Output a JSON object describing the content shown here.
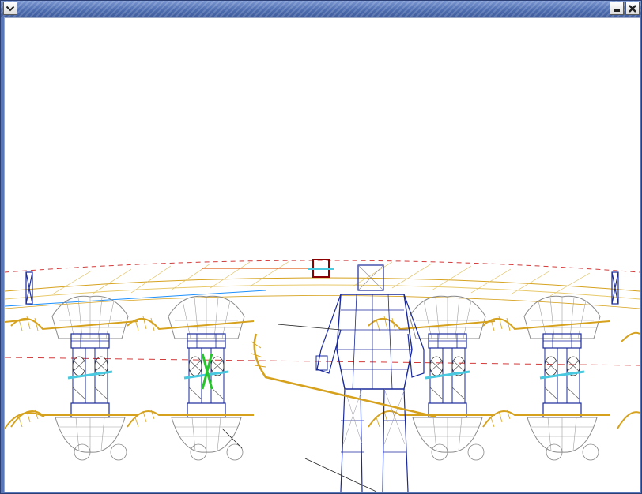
{
  "window": {
    "title": "",
    "buttons": {
      "menu": "window-menu",
      "minimize": "minimize",
      "close": "close"
    }
  },
  "colors": {
    "titlebar": "#5777b8",
    "viewport_bg": "#ffffff",
    "wire_dark": "#1a2a9a",
    "wire_grey": "#8a8a8a",
    "wire_gold": "#d6a21e",
    "wire_cyan": "#48c9e0",
    "wire_red": "#d23a3a",
    "wire_green": "#27c42d"
  },
  "icons": {
    "menu": "chevron-down-icon",
    "minimize": "minimize-icon",
    "close": "close-icon"
  }
}
